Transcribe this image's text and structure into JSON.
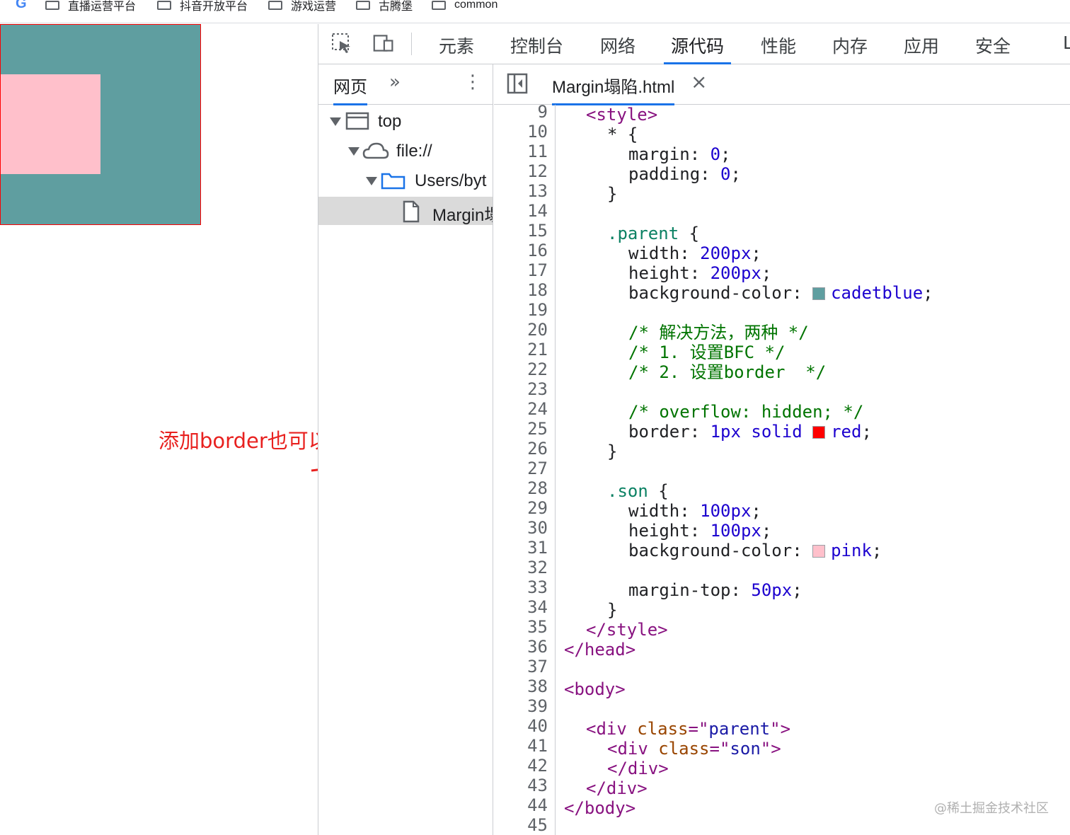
{
  "bookmarks": {
    "google_letter": "G",
    "items": [
      {
        "label": "直播运营平台"
      },
      {
        "label": "抖音开放平台"
      },
      {
        "label": "游戏运营"
      },
      {
        "label": "古腾堡"
      },
      {
        "label": "common"
      }
    ]
  },
  "preview": {
    "parent_color": "#5f9ea0",
    "son_color": "#ffc0cb",
    "border_color": "#ff0000"
  },
  "annotation": {
    "text": "添加border也可以解决",
    "color": "#e8211f"
  },
  "devtools": {
    "tabs": [
      {
        "label": "元素",
        "active": false
      },
      {
        "label": "控制台",
        "active": false
      },
      {
        "label": "网络",
        "active": false
      },
      {
        "label": "源代码",
        "active": true
      },
      {
        "label": "性能",
        "active": false
      },
      {
        "label": "内存",
        "active": false
      },
      {
        "label": "应用",
        "active": false
      },
      {
        "label": "安全",
        "active": false
      },
      {
        "label": "L",
        "active": false
      }
    ],
    "navigator": {
      "tab_label": "网页",
      "more": "»",
      "menu": "⋮",
      "tree": [
        {
          "label": "top",
          "icon": "frame-icon"
        },
        {
          "label": "file://",
          "icon": "cloud-icon"
        },
        {
          "label": "Users/byt",
          "icon": "folder-icon"
        },
        {
          "label": "Margin塌",
          "icon": "file-icon"
        }
      ]
    },
    "editor": {
      "file_tab": "Margin塌陷.html",
      "close": "×",
      "line_numbers": [
        "9",
        "10",
        "11",
        "12",
        "13",
        "14",
        "15",
        "16",
        "17",
        "18",
        "19",
        "20",
        "21",
        "22",
        "23",
        "24",
        "25",
        "26",
        "27",
        "28",
        "29",
        "30",
        "31",
        "32",
        "33",
        "34",
        "35",
        "36",
        "37",
        "38",
        "39",
        "40",
        "41",
        "42",
        "43",
        "44",
        "45"
      ],
      "code": {
        "l9_a": "<",
        "l9_b": "style",
        "l9_c": ">",
        "l10": "* {",
        "l11_a": "margin: ",
        "l11_b": "0",
        "l11_c": ";",
        "l12_a": "padding: ",
        "l12_b": "0",
        "l12_c": ";",
        "l13": "}",
        "l15_a": ".parent",
        "l15_b": " {",
        "l16_a": "width: ",
        "l16_b": "200px",
        "l16_c": ";",
        "l17_a": "height: ",
        "l17_b": "200px",
        "l17_c": ";",
        "l18_a": "background-color: ",
        "l18_b": "cadetblue",
        "l18_c": ";",
        "l20": "/* 解决方法，两种 */",
        "l21": "/* 1. 设置BFC */",
        "l22": "/* 2. 设置border  */",
        "l24": "/* overflow: hidden; */",
        "l25_a": "border: ",
        "l25_b": "1px",
        "l25_c": " solid ",
        "l25_d": "red",
        "l25_e": ";",
        "l26": "}",
        "l28_a": ".son",
        "l28_b": " {",
        "l29_a": "width: ",
        "l29_b": "100px",
        "l29_c": ";",
        "l30_a": "height: ",
        "l30_b": "100px",
        "l30_c": ";",
        "l31_a": "background-color: ",
        "l31_b": "pink",
        "l31_c": ";",
        "l33_a": "margin-top: ",
        "l33_b": "50px",
        "l33_c": ";",
        "l34": "}",
        "l35_a": "</",
        "l35_b": "style",
        "l35_c": ">",
        "l36_a": "</",
        "l36_b": "head",
        "l36_c": ">",
        "l38_a": "<",
        "l38_b": "body",
        "l38_c": ">",
        "l40_a": "<",
        "l40_b": "div",
        "l40_c": " class",
        "l40_d": "=\"",
        "l40_e": "parent",
        "l40_f": "\">",
        "l41_a": "<",
        "l41_b": "div",
        "l41_c": " class",
        "l41_d": "=\"",
        "l41_e": "son",
        "l41_f": "\">",
        "l42_a": "</",
        "l42_b": "div",
        "l42_c": ">",
        "l43_a": "</",
        "l43_b": "div",
        "l43_c": ">",
        "l44_a": "</",
        "l44_b": "body",
        "l44_c": ">"
      },
      "swatches": {
        "cadetblue": "#5f9ea0",
        "red": "#ff0000",
        "pink": "#ffc0cb"
      }
    }
  },
  "watermark": "@稀土掘金技术社区"
}
